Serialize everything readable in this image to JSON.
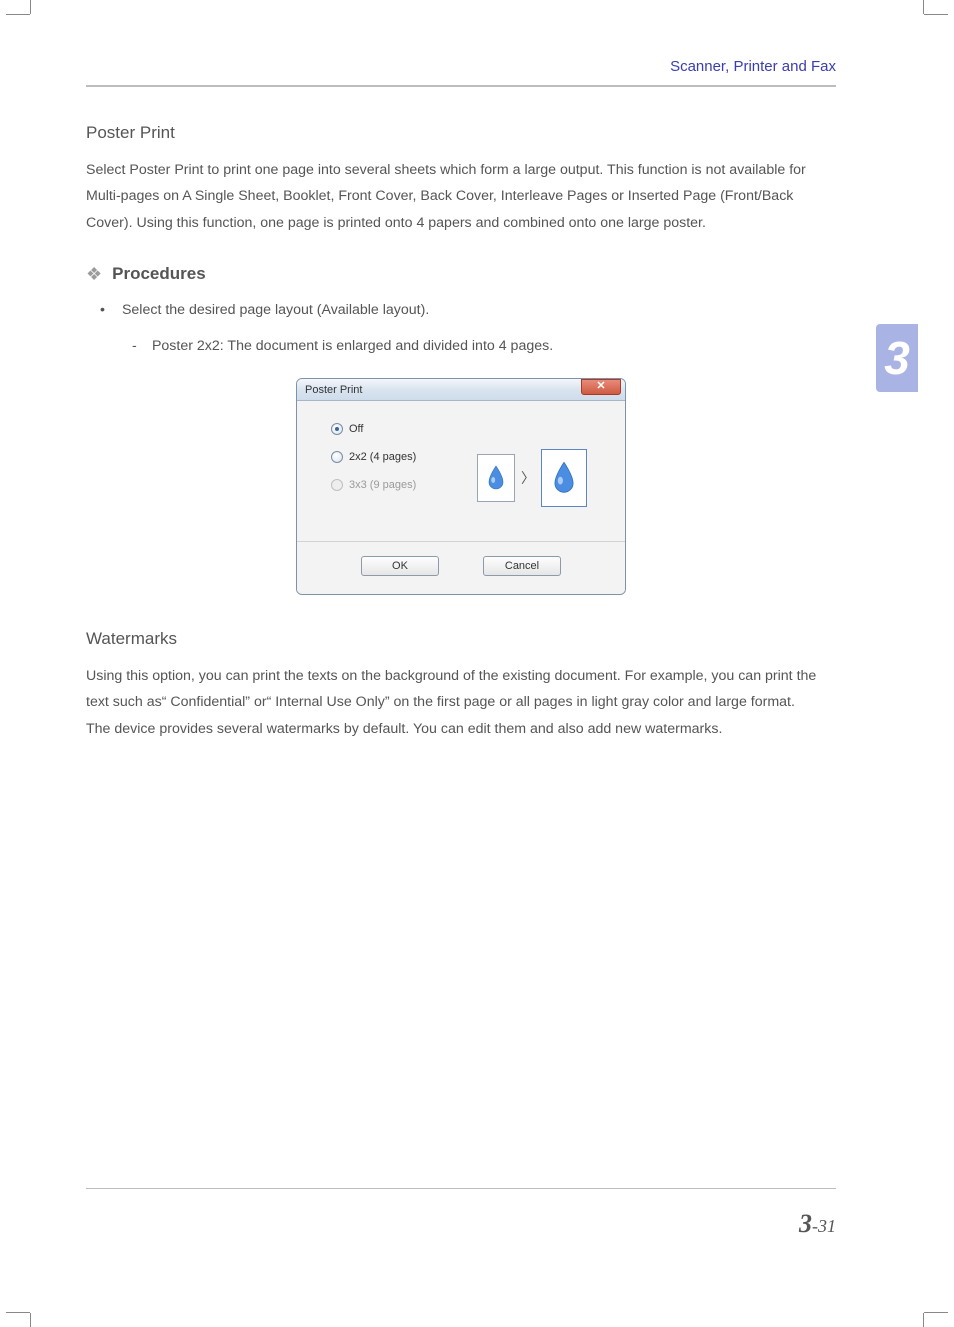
{
  "header": {
    "running_title": "Scanner, Printer and Fax"
  },
  "chapter_tab": "3",
  "sections": {
    "poster_print": {
      "title": "Poster Print",
      "body": "Select Poster Print to print one page into several sheets which form a large output. This function is not available for Multi-pages on A Single Sheet, Booklet, Front Cover, Back Cover, Interleave Pages or Inserted Page (Front/Back Cover). Using this function, one page is printed onto 4 papers and combined onto one large poster."
    },
    "procedures": {
      "heading": "Procedures",
      "bullet": "Select the desired page layout (Available layout).",
      "dash": "Poster 2x2: The document is enlarged and divided into 4 pages."
    },
    "watermarks": {
      "title": "Watermarks",
      "body": "Using this option, you can print the texts on the background of the existing document. For example, you can print the text such as“ Confidential” or“ Internal Use Only” on the first page or all pages in light gray color and large format.\nThe device provides several watermarks by default. You can edit them and also add new watermarks."
    }
  },
  "dialog": {
    "title": "Poster Print",
    "options": {
      "off": "Off",
      "opt2x2": "2x2 (4 pages)",
      "opt3x3": "3x3 (9 pages)"
    },
    "buttons": {
      "ok": "OK",
      "cancel": "Cancel"
    }
  },
  "footer": {
    "chapter": "3",
    "sep_page": "-31"
  }
}
